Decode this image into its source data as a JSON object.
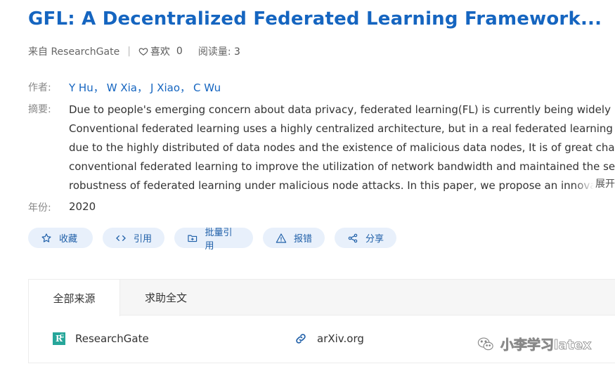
{
  "paper": {
    "title": "GFL: A Decentralized Federated Learning Framework...",
    "source": "来自 ResearchGate",
    "like_label": "喜欢",
    "like_count": "0",
    "reads_label": "阅读量:",
    "reads_count": "3",
    "authors_label": "作者:",
    "authors": [
      "Y Hu",
      "W Xia",
      "J Xiao",
      "C Wu"
    ],
    "author_separator": "，",
    "abstract_label": "摘要:",
    "abstract_lines": [
      "Due to people's emerging concern about data privacy, federated learning(FL) is currently being widely used.",
      "Conventional federated learning uses a highly centralized architecture, but in a real federated learning scenario,",
      "due to the highly distributed of data nodes and the existence of malicious data nodes, It is of great challenges for",
      "conventional federated learning to improve the utilization of network bandwidth and maintained the security and",
      "robustness of federated learning under malicious node attacks. In this paper, we propose an innovative Ring"
    ],
    "expand_label": "展开",
    "year_label": "年份:",
    "year": "2020"
  },
  "actions": {
    "favorite": "收藏",
    "cite": "引用",
    "batch_cite": "批量引用",
    "report": "报错",
    "share": "分享"
  },
  "sources_panel": {
    "tabs": [
      "全部来源",
      "求助全文"
    ],
    "active_tab": 0,
    "sources": [
      {
        "name": "ResearchGate",
        "icon": "researchgate-logo-icon"
      },
      {
        "name": "arXiv.org",
        "icon": "link-icon"
      }
    ]
  },
  "watermark": {
    "text": "小李学习latex",
    "icon": "wechat-icon"
  },
  "colors": {
    "accent": "#1565c0",
    "button_bg": "#e8f0fb",
    "rg_green": "#26a69a"
  }
}
